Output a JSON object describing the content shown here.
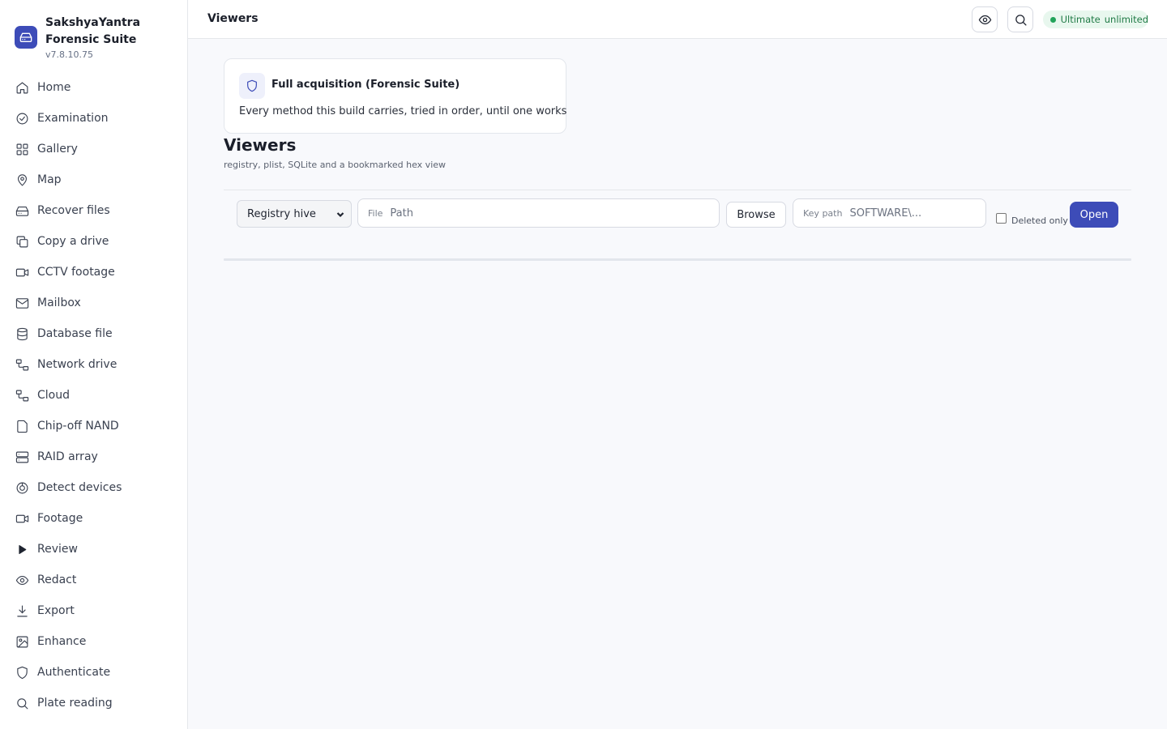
{
  "app": {
    "name": "SakshyaYantra Forensic Suite",
    "version": "v7.8.10.75"
  },
  "sidebar": {
    "items": [
      {
        "label": "Home",
        "icon": "home-icon"
      },
      {
        "label": "Examination",
        "icon": "check-circle-icon"
      },
      {
        "label": "Gallery",
        "icon": "grid-icon"
      },
      {
        "label": "Map",
        "icon": "map-pin-icon"
      },
      {
        "label": "Recover files",
        "icon": "hard-drive-icon"
      },
      {
        "label": "Copy a drive",
        "icon": "copy-icon"
      },
      {
        "label": "CCTV footage",
        "icon": "video-icon"
      },
      {
        "label": "Mailbox",
        "icon": "mail-icon"
      },
      {
        "label": "Database file",
        "icon": "database-icon"
      },
      {
        "label": "Network drive",
        "icon": "network-icon"
      },
      {
        "label": "Cloud",
        "icon": "cloud-network-icon"
      },
      {
        "label": "Chip-off NAND",
        "icon": "chip-icon"
      },
      {
        "label": "RAID array",
        "icon": "server-icon"
      },
      {
        "label": "Detect devices",
        "icon": "target-icon"
      },
      {
        "label": "Footage",
        "icon": "video-icon"
      },
      {
        "label": "Review",
        "icon": "play-icon"
      },
      {
        "label": "Redact",
        "icon": "eye-icon"
      },
      {
        "label": "Export",
        "icon": "download-icon"
      },
      {
        "label": "Enhance",
        "icon": "image-icon"
      },
      {
        "label": "Authenticate",
        "icon": "shield-icon"
      },
      {
        "label": "Plate reading",
        "icon": "search-icon"
      }
    ]
  },
  "header": {
    "title": "Viewers",
    "license_plan": "Ultimate",
    "license_status": "unlimited",
    "license_color": "#22a35a"
  },
  "card": {
    "title": "Full acquisition (Forensic Suite)",
    "description": "Every method this build carries, tried in order, until one works"
  },
  "page": {
    "title": "Viewers",
    "subtitle": "registry, plist, SQLite and a bookmarked hex view"
  },
  "toolbar": {
    "type_select": "Registry hive",
    "file_label": "File",
    "file_placeholder": "Path",
    "browse_label": "Browse",
    "key_label": "Key path",
    "key_placeholder": "SOFTWARE\\...",
    "deleted_only_label": "Deleted only",
    "deleted_only_checked": false,
    "open_label": "Open"
  },
  "colors": {
    "accent": "#3d4cb8",
    "background": "#f8f9fc"
  }
}
